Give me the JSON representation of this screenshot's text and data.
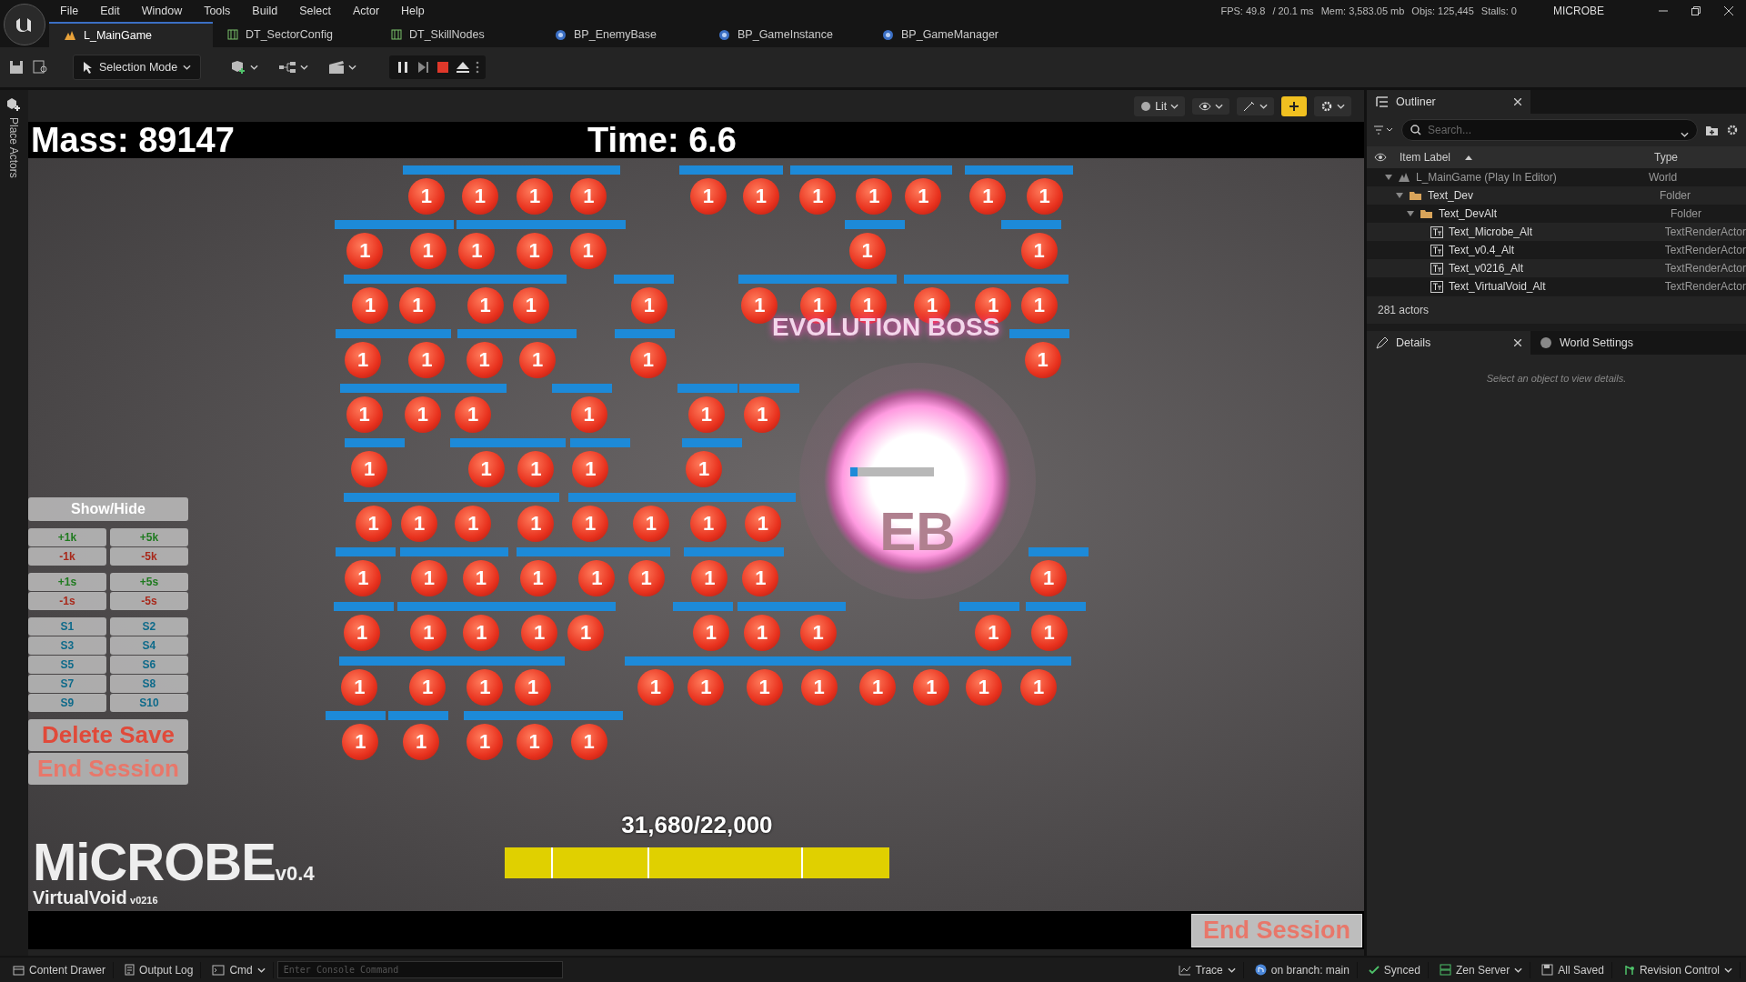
{
  "menu": [
    "File",
    "Edit",
    "Window",
    "Tools",
    "Build",
    "Select",
    "Actor",
    "Help"
  ],
  "stats": [
    "FPS: 49.8",
    "/ 20.1 ms",
    "Mem: 3,583.05 mb",
    "Objs: 125,445",
    "Stalls: 0"
  ],
  "project": "MICROBE",
  "tabs": [
    {
      "label": "L_MainGame",
      "kind": "level",
      "selected": true
    },
    {
      "label": "DT_SectorConfig",
      "kind": "table",
      "selected": false
    },
    {
      "label": "DT_SkillNodes",
      "kind": "table",
      "selected": false
    },
    {
      "label": "BP_EnemyBase",
      "kind": "blueprint",
      "selected": false
    },
    {
      "label": "BP_GameInstance",
      "kind": "blueprint",
      "selected": false
    },
    {
      "label": "BP_GameManager",
      "kind": "blueprint",
      "selected": false
    }
  ],
  "toolbar": {
    "mode": "Selection Mode"
  },
  "side_tab": "Place Actors",
  "viewport": {
    "view_mode": "Lit"
  },
  "hud": {
    "mass": "Mass: 89147",
    "time": "Time: 6.6",
    "boss_label": "EVOLUTION BOSS",
    "boss_mark": "EB",
    "progress_text": "31,680/22,000",
    "progress": {
      "level": 1
    },
    "logo": "MiCROBE",
    "version": "v0.4",
    "subtitle": "VirtualVoid",
    "build": "v0216",
    "end_session": "End Session"
  },
  "dev_panel": {
    "toggle": "Show/Hide",
    "groups": [
      [
        {
          "label": "+1k",
          "kind": "add"
        },
        {
          "label": "+5k",
          "kind": "add"
        },
        {
          "label": "-1k",
          "kind": "remove"
        },
        {
          "label": "-5k",
          "kind": "remove"
        }
      ],
      [
        {
          "label": "+1s",
          "kind": "add"
        },
        {
          "label": "+5s",
          "kind": "add"
        },
        {
          "label": "-1s",
          "kind": "remove"
        },
        {
          "label": "-5s",
          "kind": "remove"
        }
      ],
      [
        {
          "label": "S1",
          "kind": "slot"
        },
        {
          "label": "S2",
          "kind": "slot"
        },
        {
          "label": "S3",
          "kind": "slot"
        },
        {
          "label": "S4",
          "kind": "slot"
        },
        {
          "label": "S5",
          "kind": "slot"
        },
        {
          "label": "S6",
          "kind": "slot"
        },
        {
          "label": "S7",
          "kind": "slot"
        },
        {
          "label": "S8",
          "kind": "slot"
        },
        {
          "label": "S9",
          "kind": "slot"
        },
        {
          "label": "S10",
          "kind": "slot"
        }
      ]
    ],
    "actions": [
      {
        "label": "Delete Save",
        "kind": "danger"
      },
      {
        "label": "End Session",
        "kind": "muted"
      }
    ]
  },
  "enemies": [
    "1",
    "1",
    "1",
    "1",
    "1",
    "1",
    "1",
    "1",
    "1",
    "1",
    "1",
    "1",
    "1",
    "1",
    "1",
    "1",
    "1",
    "1",
    "1",
    "1",
    "1",
    "1",
    "1",
    "1",
    "1",
    "1",
    "1",
    "1",
    "1",
    "1",
    "1",
    "1",
    "1",
    "1",
    "1",
    "1",
    "1",
    "1",
    "1",
    "1",
    "1",
    "1",
    "1",
    "1",
    "1",
    "1",
    "1",
    "1",
    "1",
    "1",
    "1",
    "1",
    "1",
    "1",
    "1",
    "1",
    "1",
    "1",
    "1",
    "1",
    "1",
    "1",
    "1",
    "1",
    "1",
    "1",
    "1",
    "1",
    "1",
    "1",
    "1",
    "1",
    "1",
    "1",
    "1",
    "1",
    "1",
    "1",
    "1",
    "1",
    "1",
    "1",
    "1",
    "1",
    "1",
    "1",
    "1",
    "1",
    "1",
    "1"
  ],
  "outliner": {
    "title": "Outliner",
    "search_placeholder": "Search...",
    "columns": [
      "Item Label",
      "Type"
    ],
    "tree": [
      {
        "label": "L_MainGame (Play In Editor)",
        "type": "World",
        "kind": "world",
        "expanded": true,
        "children": [
          {
            "label": "Text_Dev",
            "type": "Folder",
            "kind": "folder",
            "expanded": true,
            "children": [
              {
                "label": "Text_DevAlt",
                "type": "Folder",
                "kind": "folder",
                "expanded": true,
                "children": [
                  {
                    "label": "Text_Microbe_Alt",
                    "type": "TextRenderActor",
                    "kind": "text_actor"
                  },
                  {
                    "label": "Text_v0.4_Alt",
                    "type": "TextRenderActor",
                    "kind": "text_actor"
                  },
                  {
                    "label": "Text_v0216_Alt",
                    "type": "TextRenderActor",
                    "kind": "text_actor"
                  },
                  {
                    "label": "Text_VirtualVoid_Alt",
                    "type": "TextRenderActor",
                    "kind": "text_actor"
                  }
                ]
              }
            ]
          }
        ]
      }
    ],
    "footer": "281 actors"
  },
  "details": {
    "tabs": [
      {
        "label": "Details",
        "kind": "details",
        "selected": true
      },
      {
        "label": "World Settings",
        "kind": "world",
        "selected": false
      }
    ],
    "empty": "Select an object to view details."
  },
  "status_bar": {
    "left": [
      {
        "label": "Content Drawer",
        "kind": "drawer"
      },
      {
        "label": "Output Log",
        "kind": "log"
      },
      {
        "label": "Cmd",
        "kind": "cmd"
      }
    ],
    "console_placeholder": "Enter Console Command",
    "right": [
      {
        "label": "Trace",
        "kind": "trace"
      },
      {
        "label": "on branch: main",
        "kind": "branch"
      },
      {
        "label": "Synced",
        "kind": "synced"
      },
      {
        "label": "Zen Server",
        "kind": "zen"
      },
      {
        "label": "All Saved",
        "kind": "saved"
      },
      {
        "label": "Revision Control",
        "kind": "revision"
      }
    ]
  }
}
